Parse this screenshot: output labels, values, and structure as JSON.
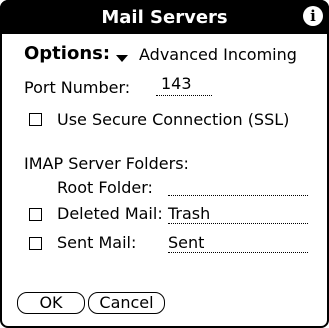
{
  "window": {
    "title": "Mail Servers",
    "info_icon": "info-icon"
  },
  "options": {
    "label": "Options:",
    "selected": "Advanced Incoming"
  },
  "port": {
    "label": "Port Number:",
    "value": "143"
  },
  "ssl": {
    "label": "Use Secure Connection (SSL)",
    "checked": false
  },
  "imap": {
    "heading": "IMAP Server Folders:",
    "root_label": "Root Folder:",
    "root_value": "",
    "deleted_label": "Deleted Mail:",
    "deleted_value": "Trash",
    "deleted_checked": false,
    "sent_label": "Sent Mail:",
    "sent_value": "Sent",
    "sent_checked": false
  },
  "buttons": {
    "ok": "OK",
    "cancel": "Cancel"
  }
}
